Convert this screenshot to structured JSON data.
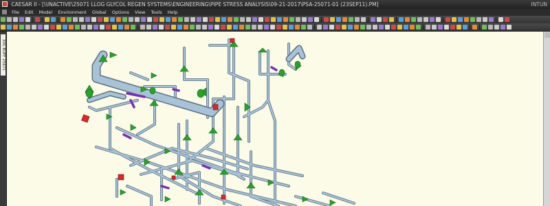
{
  "window": {
    "title": "CAESAR II - [\\\\INACTIVE\\25071 LLOG GLYCOL REGEN SYSTEMS\\ENGINEERING\\PIPE STRESS ANALYSIS\\09-21-2017\\PSA-25071-01 (23SEP11).PM]",
    "right_text": "INTUN"
  },
  "menu": {
    "items": [
      "File",
      "Edit",
      "Model",
      "Environment",
      "Global",
      "Options",
      "View",
      "Tools",
      "Help"
    ]
  },
  "side_tab": {
    "label": "XXL BUFF 25671"
  },
  "colors": {
    "canvas_bg": "#fbfbe7",
    "pipe": "#a9c2d6",
    "pipe_edge": "#5a7184",
    "support": "#2aa12a",
    "rigid": "#7a2fb0",
    "anchor": "#d42a2a"
  }
}
